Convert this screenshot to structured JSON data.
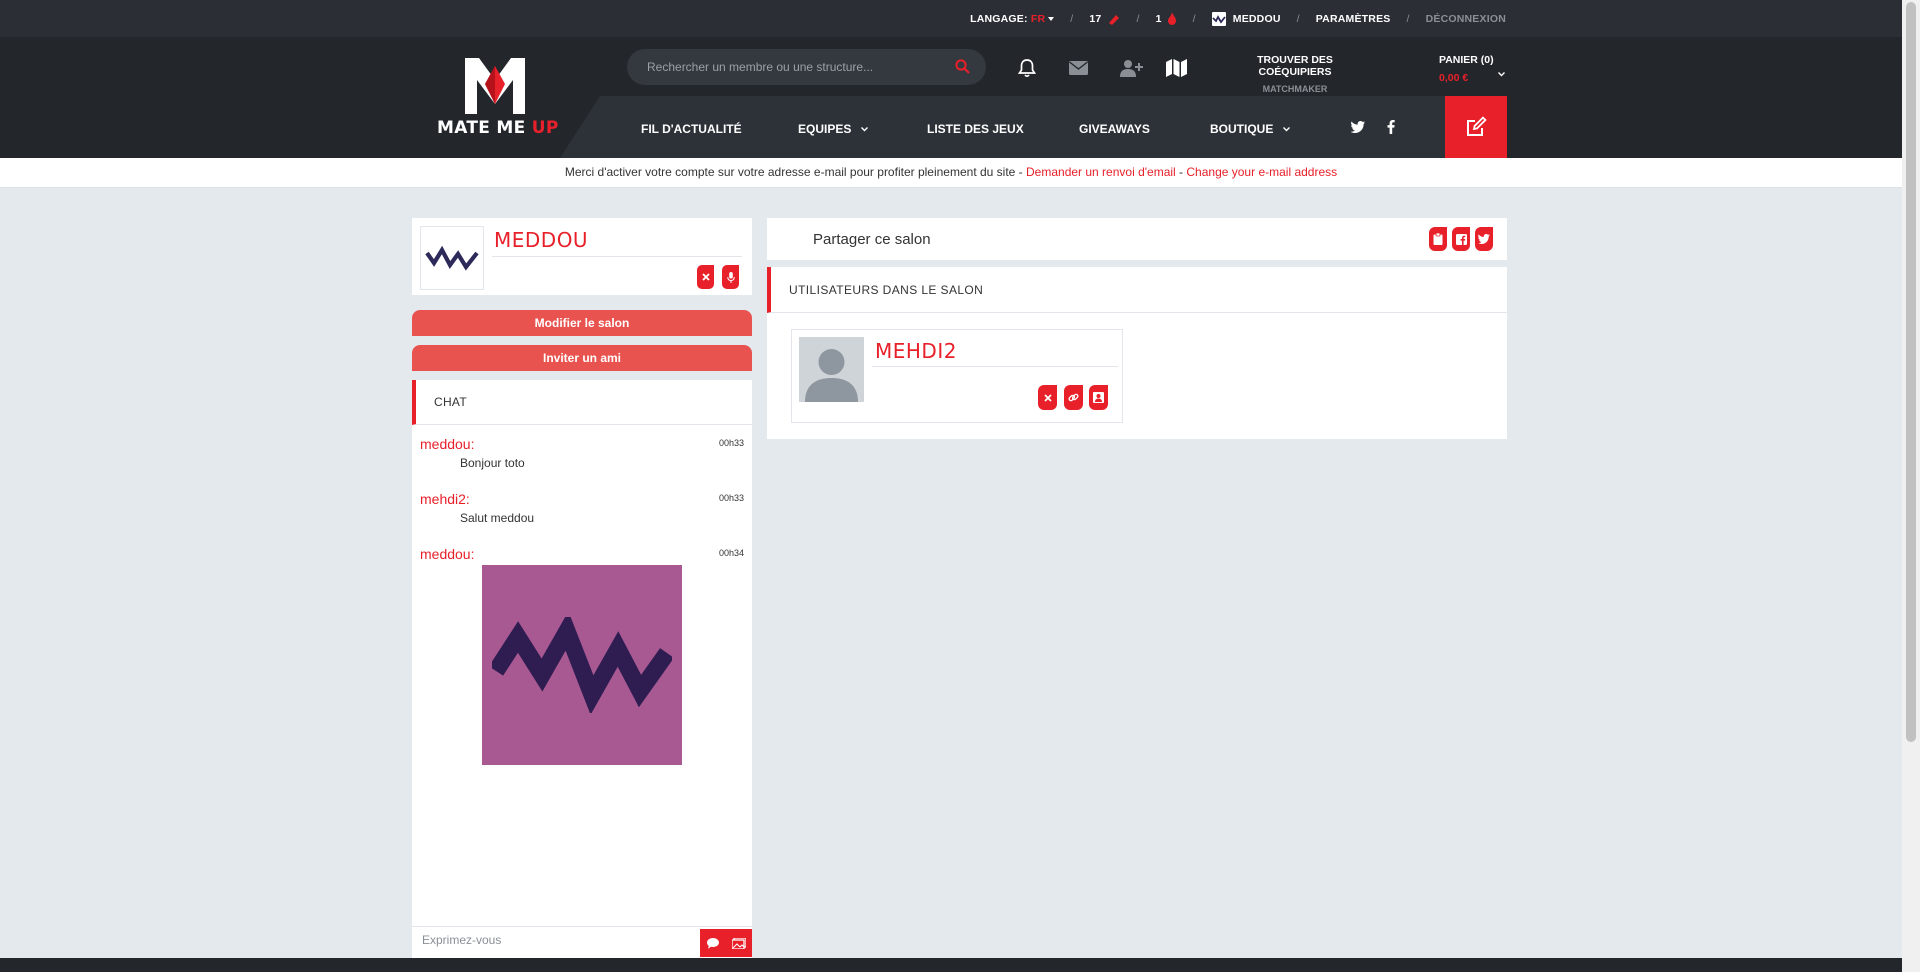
{
  "colors": {
    "accent": "#e8202a",
    "header_bg": "#23272c",
    "page_bg": "#e4e9ee"
  },
  "topbar": {
    "language_label": "LANGAGE:",
    "language_value": "FR",
    "tickets_count": "17",
    "drops_count": "1",
    "username": "MEDDOU",
    "settings": "PARAMÈTRES",
    "logout": "DÉCONNEXION",
    "separator": "/"
  },
  "logo": {
    "main": "MATE ME ",
    "accent": "UP"
  },
  "search": {
    "placeholder": "Rechercher un membre ou une structure..."
  },
  "header": {
    "finder_title": "TROUVER DES COÉQUIPIERS",
    "finder_subtitle": "MATCHMAKER",
    "cart_title": "PANIER (0)",
    "cart_total": "0,00 €"
  },
  "nav": {
    "items": [
      "FIL D'ACTUALITÉ",
      "EQUIPES",
      "LISTE DES JEUX",
      "GIVEAWAYS",
      "BOUTIQUE"
    ]
  },
  "notice": {
    "text": "Merci d'activer votre compte sur votre adresse e-mail pour profiter pleinement du site - ",
    "resend_link": "Demander un renvoi d'email",
    "separator": " - ",
    "change_link": "Change your e-mail address"
  },
  "room": {
    "owner_name": "MEDDOU",
    "edit_button": "Modifier le salon",
    "invite_button": "Inviter un ami"
  },
  "chat": {
    "title": "CHAT",
    "messages": [
      {
        "author": "meddou:",
        "time": "00h33",
        "text": "Bonjour toto"
      },
      {
        "author": "mehdi2:",
        "time": "00h33",
        "text": "Salut meddou"
      },
      {
        "author": "meddou:",
        "time": "00h34",
        "text": ""
      }
    ],
    "input_placeholder": "Exprimez-vous"
  },
  "share": {
    "label": "Partager ce salon"
  },
  "users": {
    "title": "UTILISATEURS DANS LE SALON",
    "list": [
      {
        "name": "MEHDI2"
      }
    ]
  }
}
